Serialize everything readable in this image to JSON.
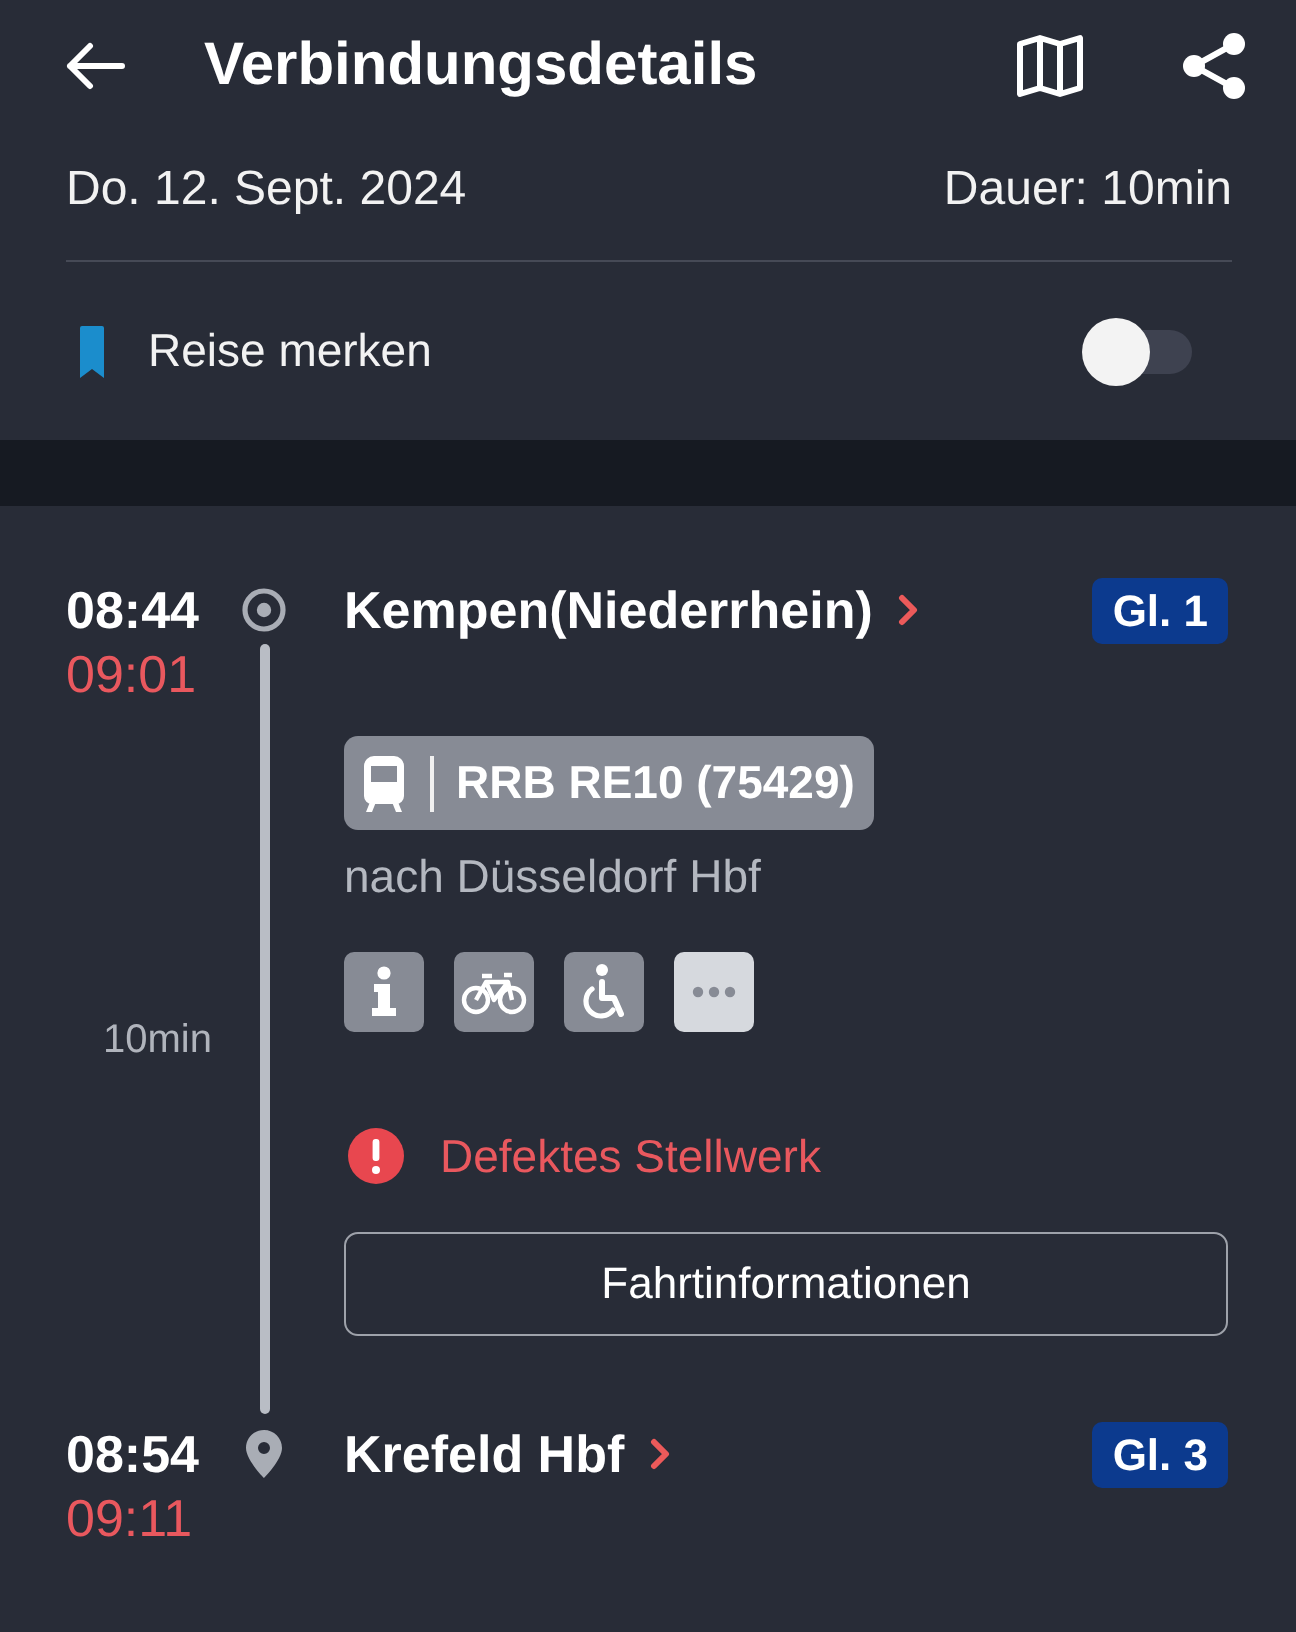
{
  "header": {
    "title": "Verbindungsdetails"
  },
  "summary": {
    "date": "Do. 12. Sept. 2024",
    "duration": "Dauer: 10min"
  },
  "save_trip": {
    "label": "Reise merken",
    "on": false
  },
  "stops": [
    {
      "kind": "origin",
      "scheduled": "08:44",
      "actual": "09:01",
      "delayed": true,
      "station": "Kempen(Niederrhein)",
      "platform": "Gl. 1"
    },
    {
      "kind": "destination",
      "scheduled": "08:54",
      "actual": "09:11",
      "delayed": true,
      "station": "Krefeld Hbf",
      "platform": "Gl. 3"
    }
  ],
  "leg": {
    "duration": "10min",
    "train": "RRB RE10 (75429)",
    "direction": "nach Düsseldorf Hbf",
    "attributes": [
      {
        "kind": "info"
      },
      {
        "kind": "bicycle"
      },
      {
        "kind": "wheelchair"
      },
      {
        "kind": "more"
      }
    ],
    "notice": {
      "kind": "warning",
      "text": "Defektes Stellwerk"
    },
    "button": "Fahrtinformationen"
  }
}
